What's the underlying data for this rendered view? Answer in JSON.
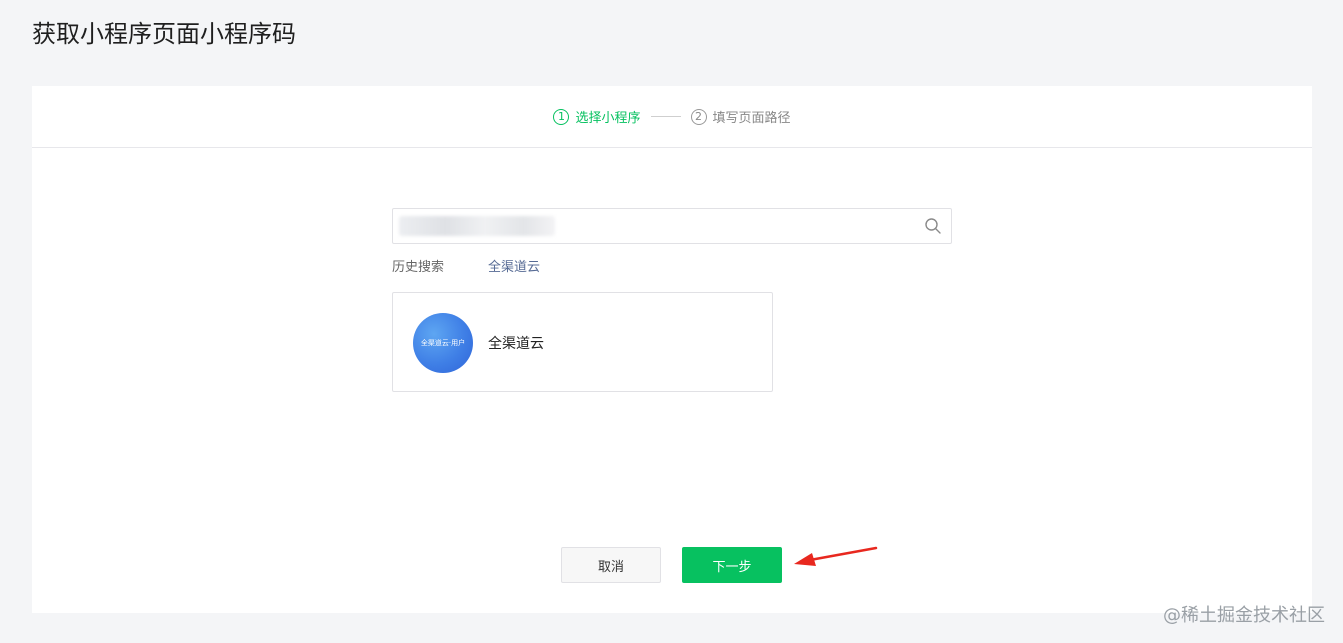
{
  "page": {
    "title": "获取小程序页面小程序码"
  },
  "steps": [
    {
      "number": "1",
      "label": "选择小程序",
      "state": "active"
    },
    {
      "number": "2",
      "label": "填写页面路径",
      "state": "inactive"
    }
  ],
  "search": {
    "value": "",
    "placeholder": ""
  },
  "history": {
    "label": "历史搜索",
    "items": [
      "全渠道云"
    ]
  },
  "results": [
    {
      "name": "全渠道云",
      "avatar_text": "全渠道云·用户"
    }
  ],
  "buttons": {
    "cancel_label": "取消",
    "next_label": "下一步"
  },
  "watermark": "@稀土掘金技术社区",
  "colors": {
    "accent": "#07c160",
    "history_link": "#576b95",
    "arrow": "#e8281f"
  }
}
